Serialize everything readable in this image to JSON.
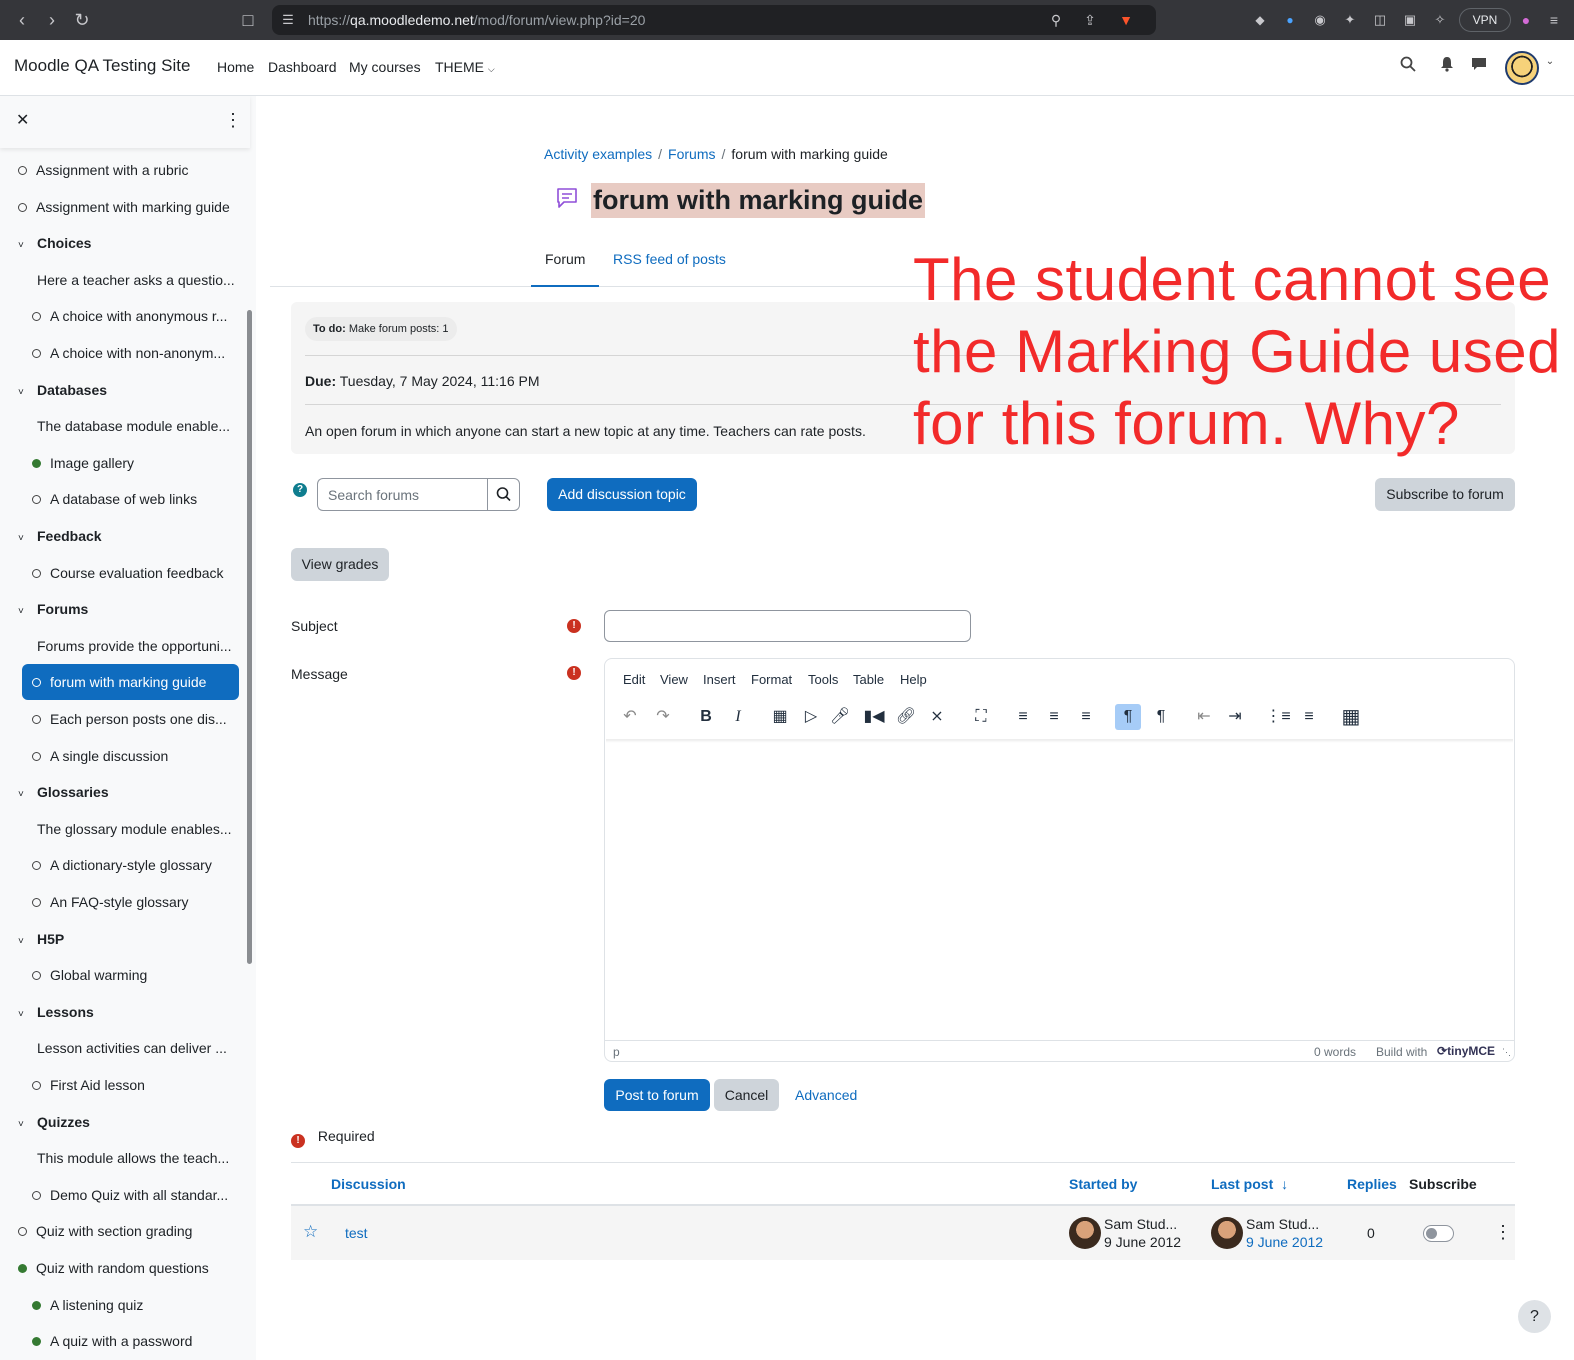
{
  "browser": {
    "url_prefix": "https://",
    "url_domain": "qa.moodledemo.net",
    "url_path": "/mod/forum/view.php?id=20",
    "vpn_label": "VPN"
  },
  "navbar": {
    "site_name": "Moodle QA Testing Site",
    "links": [
      "Home",
      "Dashboard",
      "My courses",
      "THEME"
    ]
  },
  "drawer": {
    "items": [
      {
        "label": "Assignment with a rubric",
        "kind": "activity",
        "done": false
      },
      {
        "label": "Assignment with marking guide",
        "kind": "activity",
        "done": false
      },
      {
        "label": "Choices",
        "kind": "section"
      },
      {
        "label": "Here a teacher asks a questio...",
        "kind": "summary"
      },
      {
        "label": "A choice with anonymous r...",
        "kind": "activity",
        "done": false
      },
      {
        "label": "A choice with non-anonym...",
        "kind": "activity",
        "done": false
      },
      {
        "label": "Databases",
        "kind": "section"
      },
      {
        "label": "The database module enable...",
        "kind": "summary"
      },
      {
        "label": "Image gallery",
        "kind": "activity",
        "done": true
      },
      {
        "label": "A database of web links",
        "kind": "activity",
        "done": false
      },
      {
        "label": "Feedback",
        "kind": "section"
      },
      {
        "label": "Course evaluation feedback",
        "kind": "activity",
        "done": false
      },
      {
        "label": "Forums",
        "kind": "section"
      },
      {
        "label": "Forums provide the opportuni...",
        "kind": "summary"
      },
      {
        "label": "forum with marking guide",
        "kind": "activity",
        "done": false,
        "active": true
      },
      {
        "label": "Each person posts one dis...",
        "kind": "activity",
        "done": false
      },
      {
        "label": "A single discussion",
        "kind": "activity",
        "done": false
      },
      {
        "label": "Glossaries",
        "kind": "section"
      },
      {
        "label": "The glossary module enables...",
        "kind": "summary"
      },
      {
        "label": "A dictionary-style glossary",
        "kind": "activity",
        "done": false
      },
      {
        "label": "An FAQ-style glossary",
        "kind": "activity",
        "done": false
      },
      {
        "label": "H5P",
        "kind": "section"
      },
      {
        "label": "Global warming",
        "kind": "activity",
        "done": false
      },
      {
        "label": "Lessons",
        "kind": "section"
      },
      {
        "label": "Lesson activities can deliver ...",
        "kind": "summary"
      },
      {
        "label": "First Aid lesson",
        "kind": "activity",
        "done": false
      },
      {
        "label": "Quizzes",
        "kind": "section"
      },
      {
        "label": "This module allows the teach...",
        "kind": "summary"
      },
      {
        "label": "Demo Quiz with all standar...",
        "kind": "activity",
        "done": false
      },
      {
        "label": "Quiz with section grading",
        "kind": "activity",
        "done": false
      },
      {
        "label": "Quiz with random questions",
        "kind": "activity",
        "done": true
      },
      {
        "label": "A listening quiz",
        "kind": "activity",
        "done": true
      },
      {
        "label": "A quiz with a password",
        "kind": "activity",
        "done": true
      }
    ]
  },
  "breadcrumb": {
    "items": [
      "Activity examples",
      "Forums",
      "forum with marking guide"
    ]
  },
  "page": {
    "title": "forum with marking guide",
    "tabs": [
      "Forum",
      "RSS feed of posts"
    ]
  },
  "activity_info": {
    "todo_label": "To do:",
    "todo_text": "Make forum posts: 1",
    "due_label": "Due:",
    "due_text": "Tuesday, 7 May 2024, 11:16 PM",
    "description": "An open forum in which anyone can start a new topic at any time. Teachers can rate posts."
  },
  "annotation": "The student cannot see the Marking Guide used for this forum. Why?",
  "actions": {
    "search_placeholder": "Search forums",
    "add_topic": "Add discussion topic",
    "subscribe": "Subscribe to forum",
    "view_grades": "View grades"
  },
  "form": {
    "subject_label": "Subject",
    "message_label": "Message",
    "required_label": "Required",
    "post_button": "Post to forum",
    "cancel_button": "Cancel",
    "advanced_link": "Advanced"
  },
  "editor": {
    "menu": [
      "Edit",
      "View",
      "Insert",
      "Format",
      "Tools",
      "Table",
      "Help"
    ],
    "status_path": "p",
    "word_count": "0 words",
    "build_with": "Build with",
    "brand": "tinyMCE"
  },
  "table": {
    "headers": [
      "Discussion",
      "Started by",
      "Last post",
      "Replies",
      "Subscribe"
    ],
    "rows": [
      {
        "discussion": "test",
        "started_name": "Sam Stud...",
        "started_date": "9 June 2012",
        "last_name": "Sam Stud...",
        "last_date": "9 June 2012",
        "replies": "0"
      }
    ]
  },
  "colors": {
    "primary": "#0f6cbf",
    "annotation": "#f22a2a",
    "completed": "#357a32",
    "required": "#ca3120"
  }
}
